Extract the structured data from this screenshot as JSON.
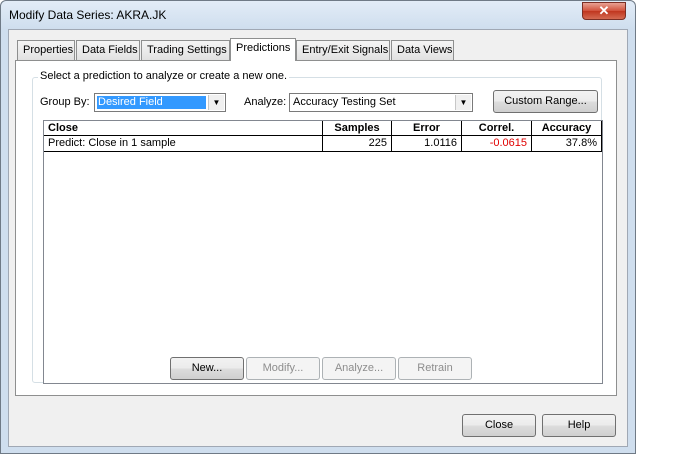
{
  "window": {
    "title": "Modify Data Series: AKRA.JK",
    "close_glyph": "✕"
  },
  "tabs": [
    {
      "label": "Properties"
    },
    {
      "label": "Data Fields"
    },
    {
      "label": "Trading Settings"
    },
    {
      "label": "Predictions",
      "active": true
    },
    {
      "label": "Entry/Exit Signals"
    },
    {
      "label": "Data Views"
    }
  ],
  "predictions": {
    "group_caption": "Select a prediction to analyze or create a new one.",
    "group_by_label": "Group By:",
    "group_by_value": "Desired Field",
    "analyze_label": "Analyze:",
    "analyze_value": "Accuracy Testing Set",
    "custom_range_button": "Custom Range...",
    "table": {
      "columns": [
        "Close",
        "Samples",
        "Error",
        "Correl.",
        "Accuracy"
      ],
      "rows": [
        {
          "name": "Predict: Close in 1 sample",
          "samples": "225",
          "error": "1.0116",
          "correl": "-0.0615",
          "accuracy": "37.8%"
        }
      ]
    },
    "buttons": {
      "new": "New...",
      "modify": "Modify...",
      "analyze": "Analyze...",
      "retrain": "Retrain"
    }
  },
  "dialog_buttons": {
    "close": "Close",
    "help": "Help"
  },
  "colors": {
    "negative_value": "#e00000",
    "selection": "#3399ff"
  },
  "icons": {
    "dropdown": "▼"
  }
}
